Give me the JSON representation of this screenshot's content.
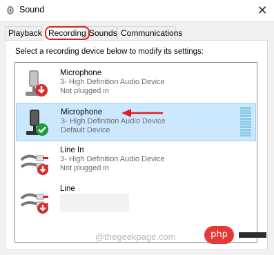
{
  "window": {
    "title": "Sound",
    "close_glyph": "✕"
  },
  "tabs": [
    {
      "label": "Playback",
      "active": false
    },
    {
      "label": "Recording",
      "active": true
    },
    {
      "label": "Sounds",
      "active": false
    },
    {
      "label": "Communications",
      "active": false
    }
  ],
  "instruction": "Select a recording device below to modify its settings:",
  "devices": [
    {
      "name": "Microphone",
      "driver": "3- High Definition Audio Device",
      "status": "Not plugged in",
      "icon": "microphone-icon",
      "badge": "unplugged-red-arrow",
      "selected": false
    },
    {
      "name": "Microphone",
      "driver": "3- High Definition Audio Device",
      "status": "Default Device",
      "icon": "microphone-icon",
      "badge": "default-green-check",
      "selected": true
    },
    {
      "name": "Line In",
      "driver": "3- High Definition Audio Device",
      "status": "Not plugged in",
      "icon": "line-in-jack-icon",
      "badge": "unplugged-red-arrow",
      "selected": false
    },
    {
      "name": "Line",
      "driver": "",
      "status": "",
      "icon": "line-in-jack-icon",
      "badge": "unplugged-red-arrow",
      "selected": false
    }
  ],
  "colors": {
    "selection": "#cce8ff",
    "highlight_red": "#e21d1d",
    "check_green": "#1e9b3a"
  },
  "watermark": {
    "text": "@thegeekpage.com",
    "badge": "php"
  }
}
